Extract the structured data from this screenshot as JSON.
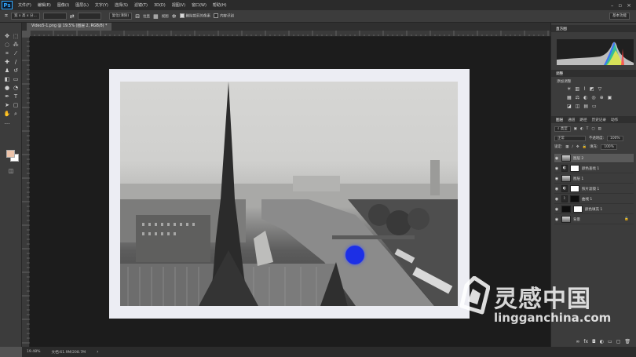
{
  "app": {
    "logo": "Ps",
    "brand_color": "#31a8ff"
  },
  "menu": [
    "文件(F)",
    "编辑(E)",
    "图像(I)",
    "图层(L)",
    "文字(Y)",
    "选择(S)",
    "滤镜(T)",
    "3D(D)",
    "视图(V)",
    "窗口(W)",
    "帮助(H)"
  ],
  "window_controls": [
    "minimize-icon",
    "maximize-icon",
    "close-icon"
  ],
  "options": {
    "tool_mode": "宽 x 高 x 分...",
    "swap_icon": "swap-icon",
    "clear_label": "复位(清除)",
    "straighten_label": "拉直",
    "overlay_label": "视图",
    "delete_cropped_label": "删除裁剪的像素",
    "delete_cropped_checked": true,
    "content_aware_label": "内容识别",
    "content_aware_checked": false,
    "workspace": "基本功能"
  },
  "document": {
    "tab_title": "Video5-1.png @ 19.5% (图层 2, RGB/8) *",
    "accent_dot_color": "#1c2fe6"
  },
  "status": {
    "zoom": "19.48%",
    "doc_size": "文档:61.9M/208.7M"
  },
  "panels": {
    "histogram_title": "直方图",
    "adjustments_title": "调整",
    "adjustments_label": "添加调整",
    "layers_tabs": [
      "图层",
      "通道",
      "路径",
      "历史记录",
      "动作"
    ],
    "filter_label": "类型",
    "blend_mode": "正常",
    "opacity_label": "不透明度:",
    "opacity_value": "100%",
    "lock_label": "锁定:",
    "fill_label": "填充:",
    "fill_value": "100%"
  },
  "layers": [
    {
      "name": "图层 2",
      "thumb": "photo",
      "selected": true
    },
    {
      "name": "颜色查找 1",
      "thumb": "white",
      "selected": false
    },
    {
      "name": "图层 1",
      "thumb": "photo",
      "selected": false
    },
    {
      "name": "照片滤镜 1",
      "thumb": "white",
      "selected": false
    },
    {
      "name": "曲线 1",
      "thumb": "black",
      "selected": false
    },
    {
      "name": "颜色填充 1",
      "thumb": "black",
      "selected": false
    },
    {
      "name": "背景",
      "thumb": "photo",
      "selected": false
    }
  ],
  "watermark": {
    "cn": "灵感中国",
    "en": "lingganchina.com"
  }
}
